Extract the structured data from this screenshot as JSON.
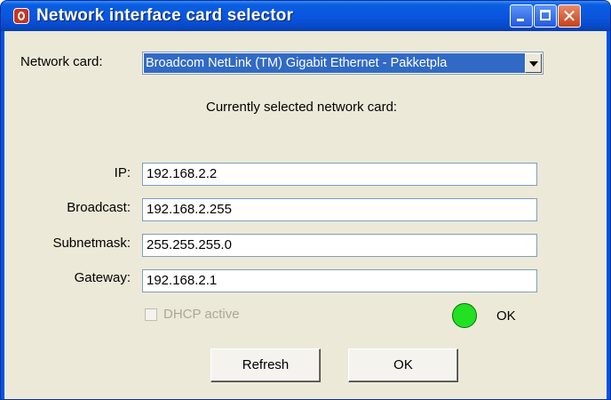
{
  "window": {
    "title": "Network interface card selector",
    "icon": "app-logo-icon"
  },
  "title_buttons": {
    "minimize": "minimize-icon",
    "maximize": "maximize-icon",
    "close": "close-icon",
    "close_glyph": "✕"
  },
  "form": {
    "network_card_label": "Network card:",
    "network_card_value": "Broadcom NetLink (TM) Gigabit Ethernet - Pakketpla",
    "current_heading": "Currently selected network card:",
    "ip_label": "IP:",
    "ip_value": "192.168.2.2",
    "broadcast_label": "Broadcast:",
    "broadcast_value": "192.168.2.255",
    "subnet_label": "Subnetmask:",
    "subnet_value": "255.255.255.0",
    "gateway_label": "Gateway:",
    "gateway_value": "192.168.2.1",
    "dhcp_label": "DHCP active",
    "dhcp_checked": false,
    "status_text": "OK",
    "status_color": "#22e022"
  },
  "buttons": {
    "refresh": "Refresh",
    "ok": "OK"
  },
  "colors": {
    "title_bar": "#0a54dd",
    "dialog_background": "#ece9d8",
    "selection": "#316ac5"
  }
}
